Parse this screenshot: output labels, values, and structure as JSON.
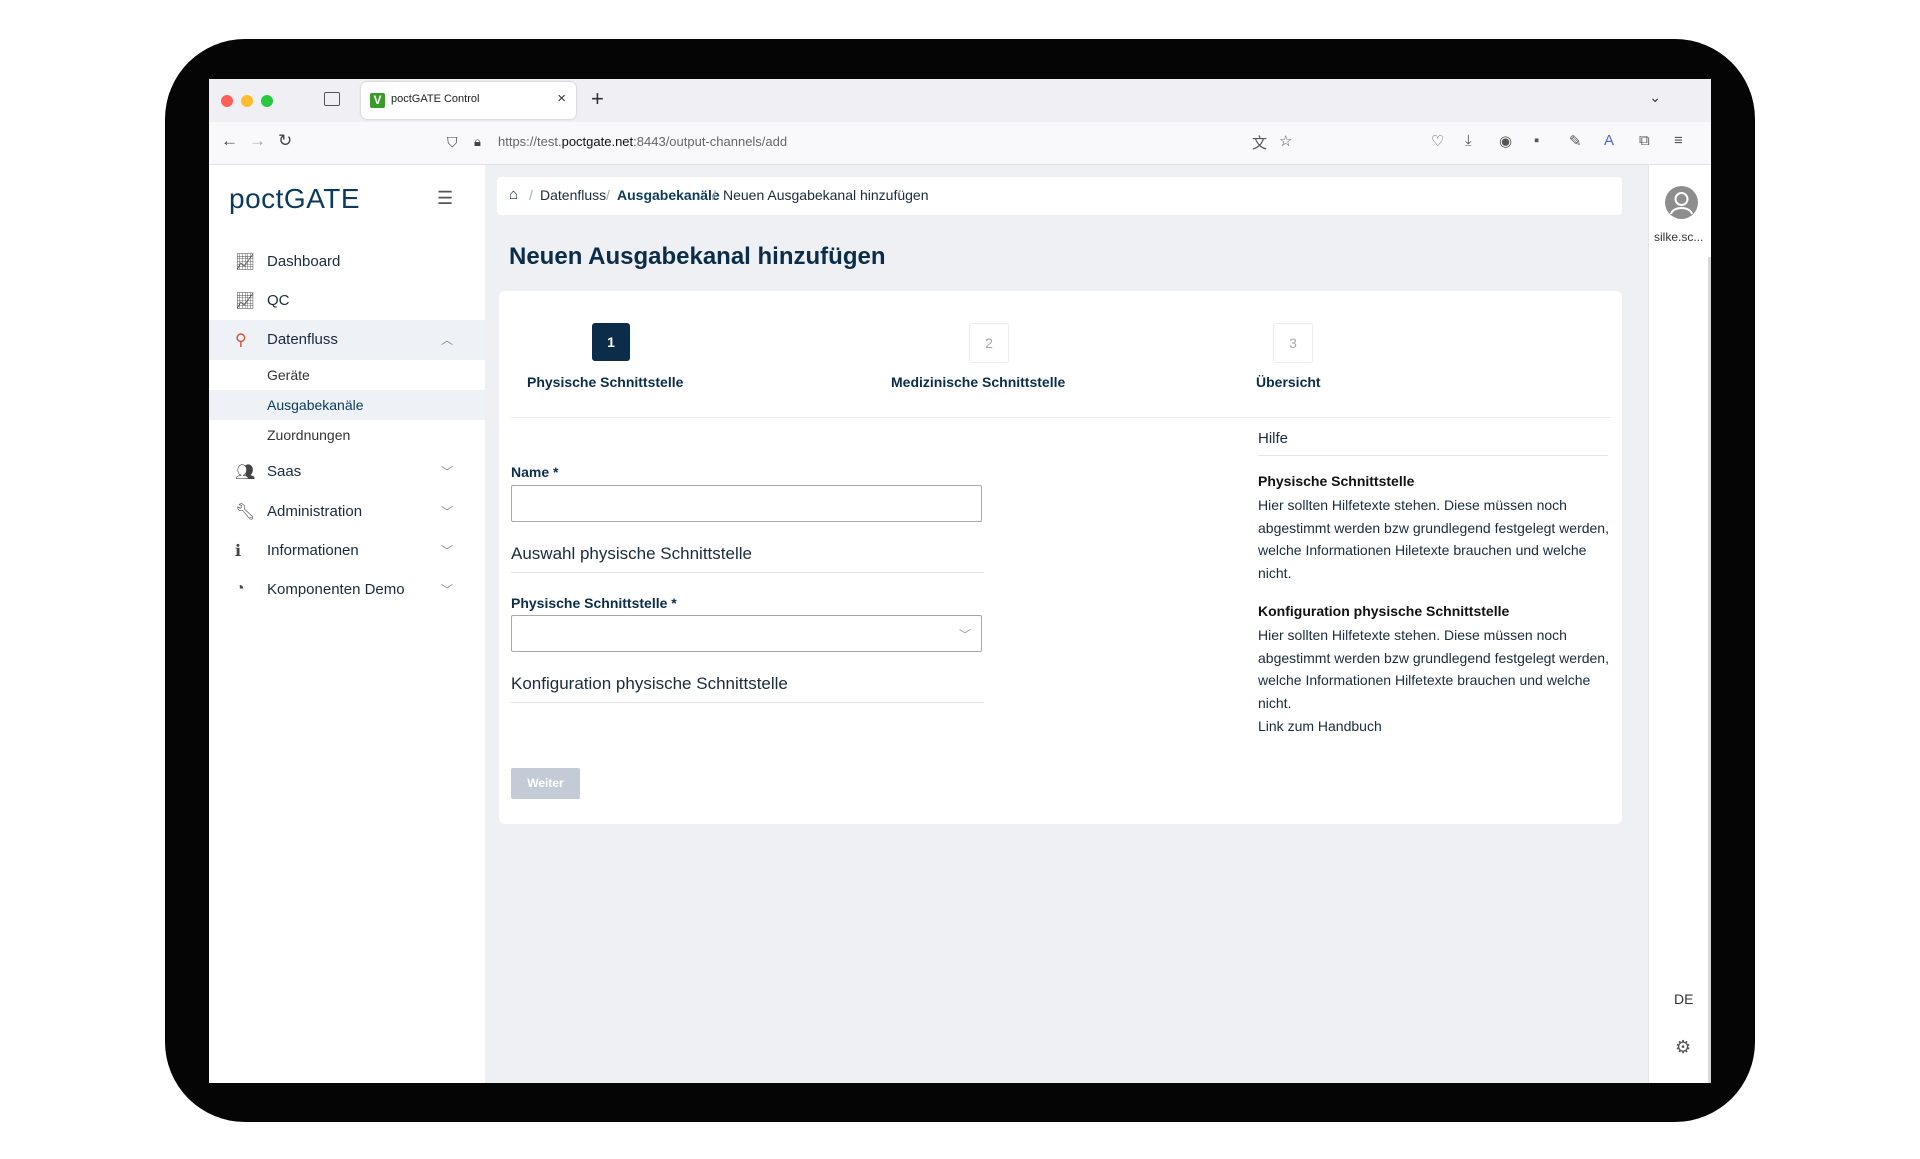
{
  "browser": {
    "tab_title": "poctGATE Control",
    "tab_favicon": "V",
    "url_prefix": "https://test.",
    "url_domain": "poctgate.net",
    "url_suffix": ":8443/output-channels/add"
  },
  "sidebar": {
    "logo": "poctGATE",
    "items": [
      {
        "label": "Dashboard",
        "icon": "chart-line-icon"
      },
      {
        "label": "QC",
        "icon": "chart-line-icon"
      },
      {
        "label": "Datenfluss",
        "icon": "share-nodes-icon"
      },
      {
        "label": "Saas",
        "icon": "users-icon"
      },
      {
        "label": "Administration",
        "icon": "wrench-icon"
      },
      {
        "label": "Informationen",
        "icon": "info-icon"
      },
      {
        "label": "Komponenten Demo",
        "icon": "palette-icon"
      }
    ],
    "datenfluss_sub": [
      "Geräte",
      "Ausgabekanäle",
      "Zuordnungen"
    ]
  },
  "breadcrumb": {
    "items": [
      "Datenfluss",
      "Ausgabekanäle",
      "Neuen Ausgabekanal hinzufügen"
    ]
  },
  "page": {
    "title": "Neuen Ausgabekanal hinzufügen"
  },
  "stepper": {
    "steps": [
      {
        "number": "1",
        "label": "Physische Schnittstelle"
      },
      {
        "number": "2",
        "label": "Medizinische Schnittstelle"
      },
      {
        "number": "3",
        "label": "Übersicht"
      }
    ]
  },
  "form": {
    "name_label": "Name *",
    "name_value": "",
    "section1": "Auswahl physische Schnittstelle",
    "physical_label": "Physische Schnittstelle *",
    "physical_value": "",
    "section2": "Konfiguration physische Schnittstelle",
    "next_button": "Weiter"
  },
  "help": {
    "title": "Hilfe",
    "h1": "Physische Schnittstelle",
    "p1": "Hier sollten Hilfetexte stehen. Diese müssen noch abgestimmt werden bzw grundlegend festgelegt werden, welche Informationen Hiletexte brauchen und welche nicht.",
    "h2": "Konfiguration physische Schnittstelle",
    "p2": "Hier sollten Hilfetexte stehen. Diese müssen noch abgestimmt werden bzw grundlegend festgelegt werden, welche Informationen Hilfetexte brauchen und welche nicht.",
    "link": "Link zum Handbuch"
  },
  "user": {
    "name": "silke.sc...",
    "language": "DE"
  }
}
